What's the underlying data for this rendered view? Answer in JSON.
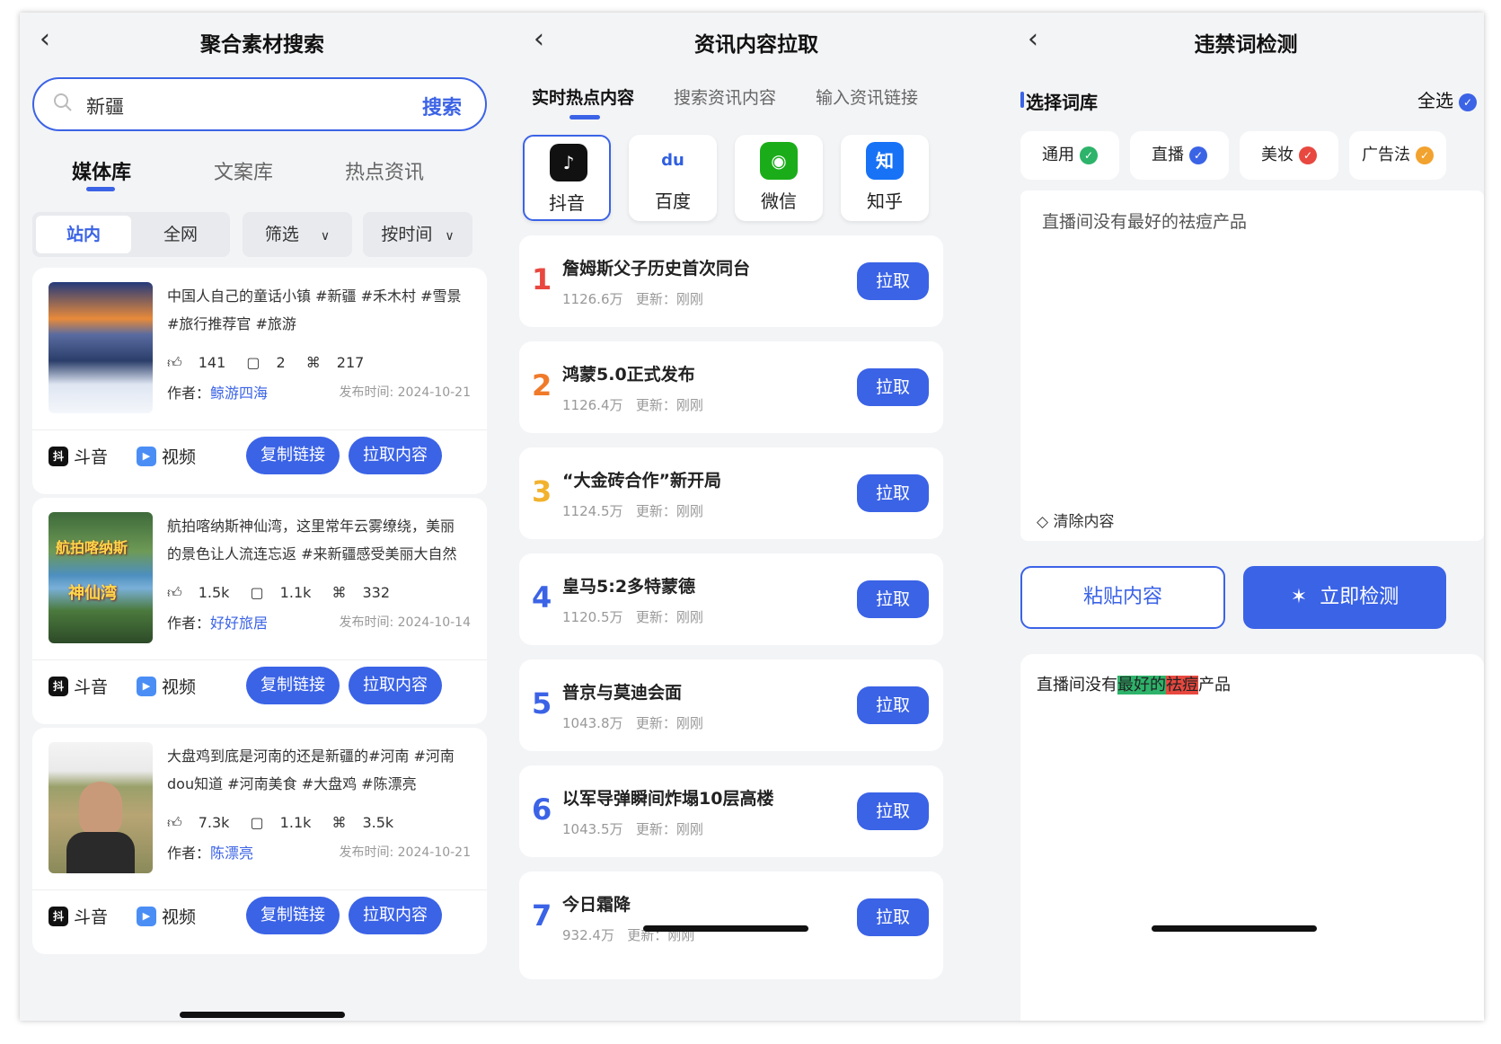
{
  "panel1": {
    "back_icon": "chevron-left-icon",
    "title": "聚合素材搜索",
    "search_value": "新疆",
    "search_button": "搜索",
    "tabs": [
      "媒体库",
      "文案库",
      "热点资讯"
    ],
    "segment": [
      "站内",
      "全网"
    ],
    "filter": "筛选",
    "sort": "按时间",
    "cards": [
      {
        "desc": "中国人自己的童话小镇 #新疆 #禾木村 #雪景 #旅行推荐官 #旅游",
        "likes": "141",
        "comments": "2",
        "shares": "217",
        "author_label": "作者：",
        "author": "鲸游四海",
        "date": "发布时间: 2024-10-21",
        "platform": "斗音",
        "type": "视频",
        "copy": "复制链接",
        "pull": "拉取内容"
      },
      {
        "desc": "航拍喀纳斯神仙湾，这里常年云雾缭绕，美丽的景色让人流连忘返 #来新疆感受美丽大自然",
        "likes": "1.5k",
        "comments": "1.1k",
        "shares": "332",
        "author_label": "作者：",
        "author": "好好旅居",
        "date": "发布时间: 2024-10-14",
        "platform": "斗音",
        "type": "视频",
        "copy": "复制链接",
        "pull": "拉取内容",
        "thumb_text": [
          "航拍喀纳斯",
          "神仙湾"
        ]
      },
      {
        "desc": "大盘鸡到底是河南的还是新疆的#河南 #河南dou知道 #河南美食 #大盘鸡 #陈漂亮",
        "likes": "7.3k",
        "comments": "1.1k",
        "shares": "3.5k",
        "author_label": "作者：",
        "author": "陈漂亮",
        "date": "发布时间: 2024-10-21",
        "platform": "斗音",
        "type": "视频",
        "copy": "复制链接",
        "pull": "拉取内容"
      }
    ]
  },
  "panel2": {
    "title": "资讯内容拉取",
    "tabs": [
      "实时热点内容",
      "搜索资讯内容",
      "输入资讯链接"
    ],
    "platforms": [
      {
        "label": "抖音",
        "icon": "douyin-icon",
        "glyph": "♪",
        "color": "#111111"
      },
      {
        "label": "百度",
        "icon": "baidu-icon",
        "glyph": "du",
        "color": "#2f5fe0"
      },
      {
        "label": "微信",
        "icon": "wechat-icon",
        "glyph": "◉",
        "color": "#1aad19"
      },
      {
        "label": "知乎",
        "icon": "zhihu-icon",
        "glyph": "知",
        "color": "#1772f6"
      }
    ],
    "hot": [
      {
        "rank": "1",
        "title": "詹姆斯父子历史首次同台",
        "heat": "1126.6万",
        "update": "更新：刚刚",
        "color": "#e8483f"
      },
      {
        "rank": "2",
        "title": "鸿蒙5.0正式发布",
        "heat": "1126.4万",
        "update": "更新：刚刚",
        "color": "#f07a2a"
      },
      {
        "rank": "3",
        "title": "“大金砖合作”新开局",
        "heat": "1124.5万",
        "update": "更新：刚刚",
        "color": "#f2b22e"
      },
      {
        "rank": "4",
        "title": "皇马5:2多特蒙德",
        "heat": "1120.5万",
        "update": "更新：刚刚",
        "color": "#3b63e6"
      },
      {
        "rank": "5",
        "title": "普京与莫迪会面",
        "heat": "1043.8万",
        "update": "更新：刚刚",
        "color": "#3b63e6"
      },
      {
        "rank": "6",
        "title": "以军导弹瞬间炸塌10层高楼",
        "heat": "1043.5万",
        "update": "更新：刚刚",
        "color": "#3b63e6"
      },
      {
        "rank": "7",
        "title": "今日霜降",
        "heat": "932.4万",
        "update": "更新：刚刚",
        "color": "#3b63e6"
      }
    ],
    "pull_label": "拉取"
  },
  "panel3": {
    "title": "违禁词检测",
    "section": "选择词库",
    "select_all": "全选",
    "chips": [
      {
        "label": "通用",
        "color": "#2db36a"
      },
      {
        "label": "直播",
        "color": "#3b63e6"
      },
      {
        "label": "美妆",
        "color": "#e8483f"
      },
      {
        "label": "广告法",
        "color": "#f2a22e"
      }
    ],
    "input_text": "直播间没有最好的祛痘产品",
    "clear": "清除内容",
    "paste": "粘贴内容",
    "detect": "立即检测",
    "result_pre": "直播间没有",
    "result_hl1": "最好的",
    "result_hl2": "祛痘",
    "result_post": "产品"
  },
  "colors": {
    "accent": "#3b63e6",
    "bg": "#f3f4f6"
  }
}
